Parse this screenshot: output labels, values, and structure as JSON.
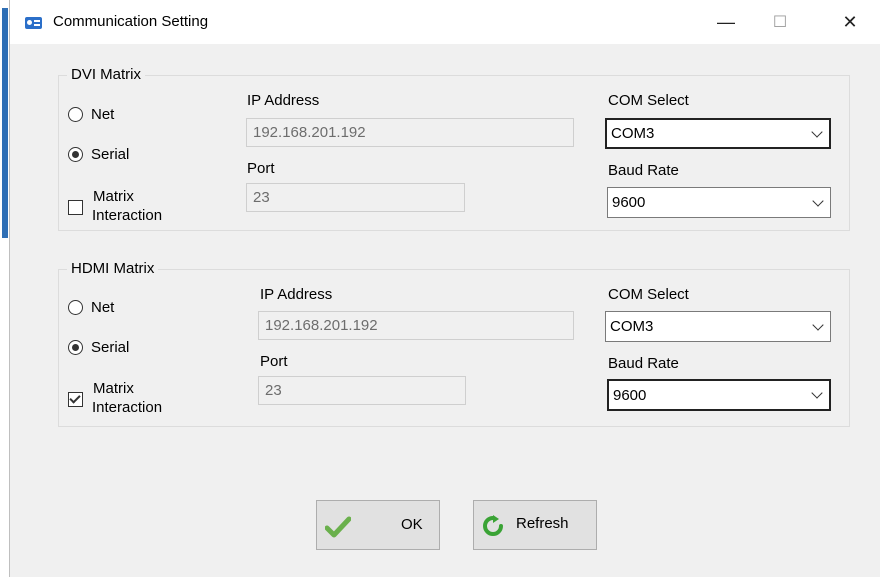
{
  "window": {
    "title": "Communication Setting",
    "minimize": "—",
    "maximize": "☐",
    "close": "✕"
  },
  "dvi": {
    "title": "DVI Matrix",
    "net_label": "Net",
    "serial_label": "Serial",
    "selected_mode": "Serial",
    "matrix_label_1": "Matrix",
    "matrix_label_2": "Interaction",
    "matrix_checked": false,
    "ip_label": "IP Address",
    "ip_value": "192.168.201.192",
    "port_label": "Port",
    "port_value": "23",
    "com_label": "COM Select",
    "com_value": "COM3",
    "baud_label": "Baud Rate",
    "baud_value": "9600"
  },
  "hdmi": {
    "title": "HDMI Matrix",
    "net_label": "Net",
    "serial_label": "Serial",
    "selected_mode": "Serial",
    "matrix_label_1": "Matrix",
    "matrix_label_2": "Interaction",
    "matrix_checked": true,
    "ip_label": "IP Address",
    "ip_value": "192.168.201.192",
    "port_label": "Port",
    "port_value": "23",
    "com_label": "COM Select",
    "com_value": "COM3",
    "baud_label": "Baud Rate",
    "baud_value": "9600"
  },
  "buttons": {
    "ok_label": "OK",
    "refresh_label": "Refresh"
  },
  "colors": {
    "ok_check": "#6ab04c",
    "refresh_green": "#3aa335",
    "window_bg": "#f0f0f0"
  }
}
